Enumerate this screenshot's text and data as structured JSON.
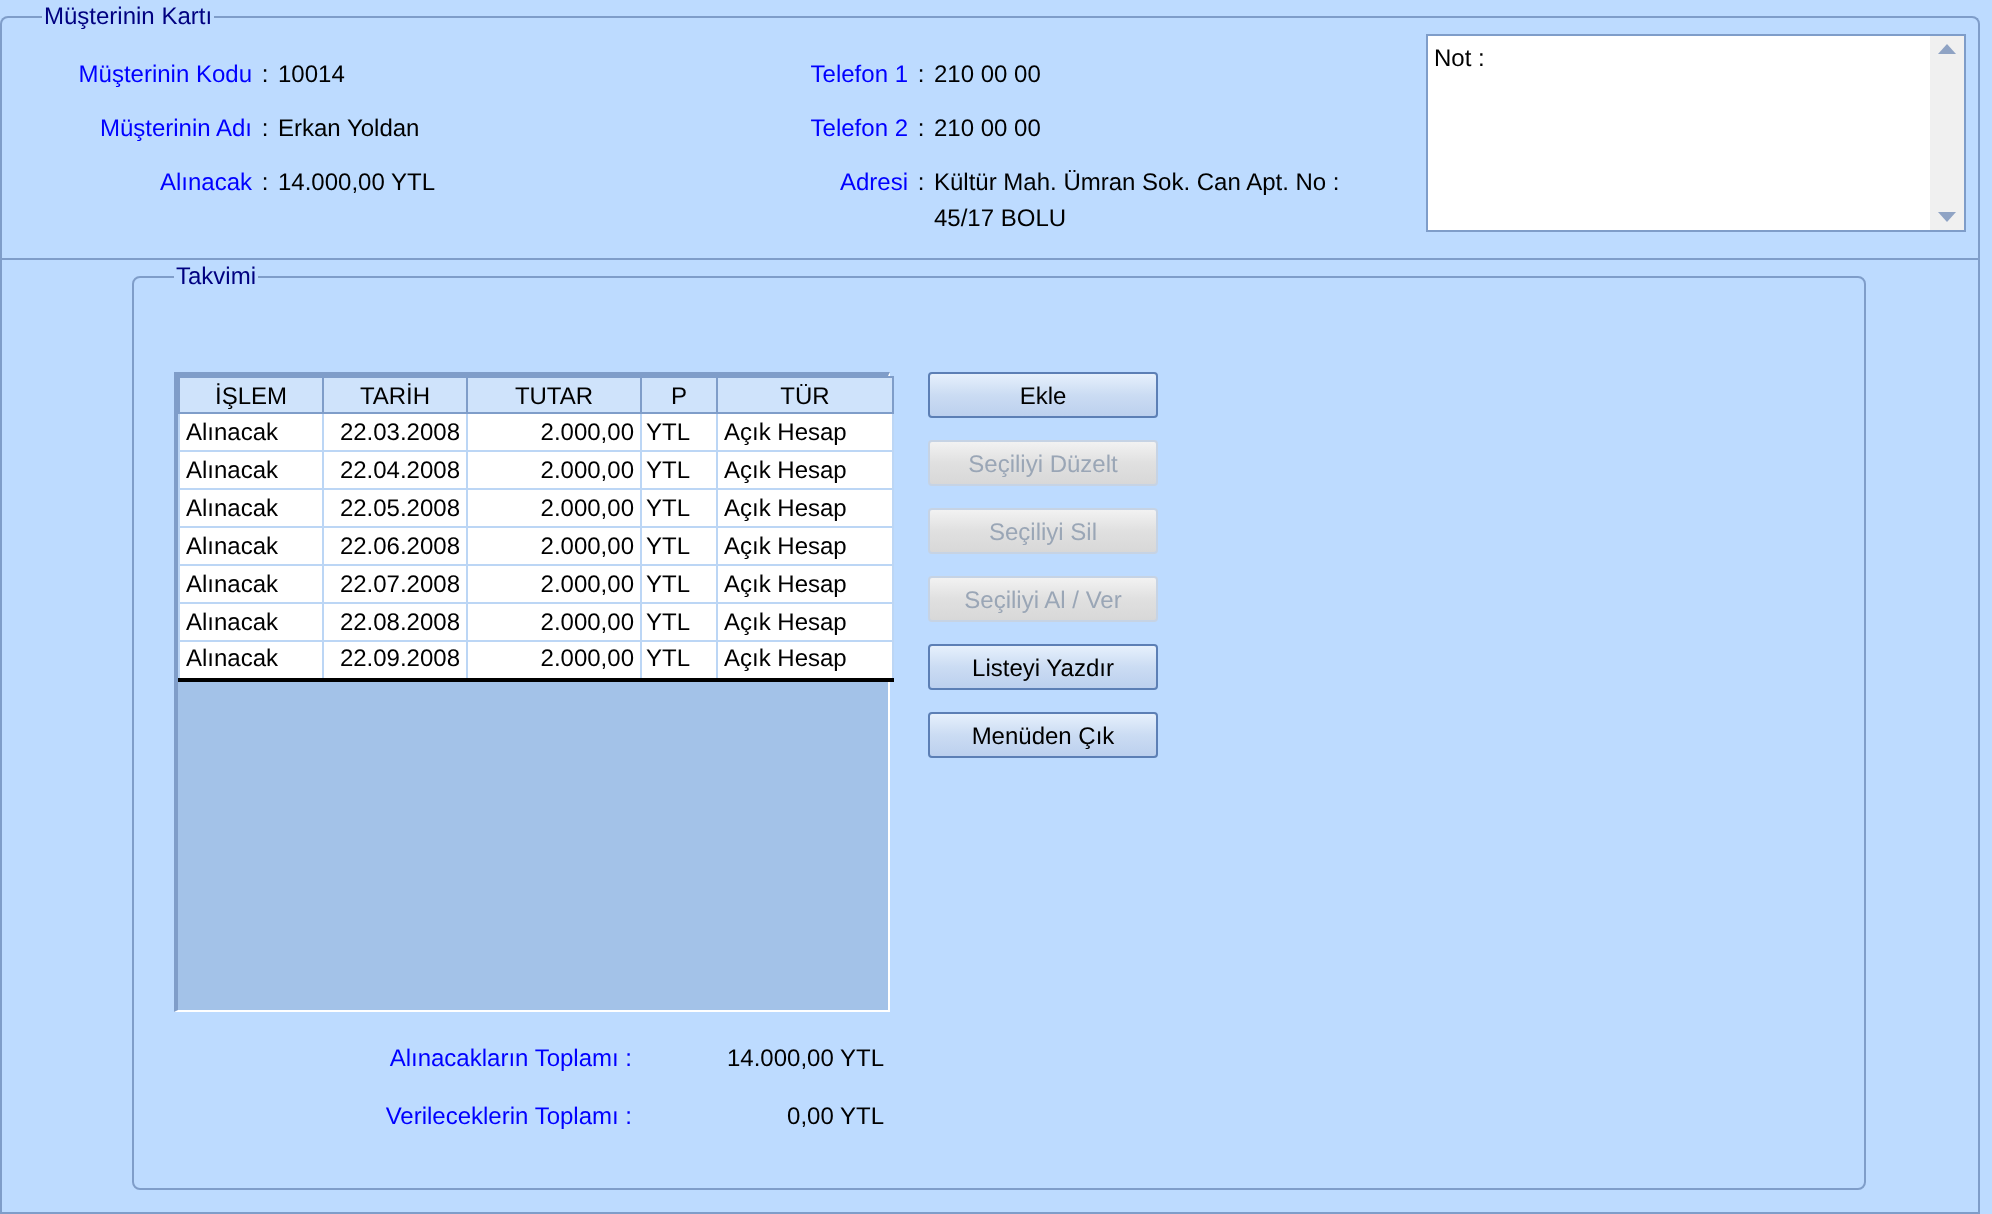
{
  "customer_card": {
    "title": "Müşterinin Kartı",
    "fields_left": [
      {
        "label": "Müşterinin Kodu",
        "separator": ":",
        "value": "10014"
      },
      {
        "label": "Müşterinin Adı",
        "separator": ":",
        "value": "Erkan Yoldan"
      },
      {
        "label": "Alınacak",
        "separator": ":",
        "value": "14.000,00 YTL"
      }
    ],
    "fields_right": [
      {
        "label": "Telefon 1",
        "separator": ":",
        "value": "210 00 00"
      },
      {
        "label": "Telefon 2",
        "separator": ":",
        "value": "210 00 00"
      },
      {
        "label": "Adresi",
        "separator": ":",
        "value": "Kültür Mah. Ümran Sok. Can Apt. No : 45/17 BOLU"
      }
    ],
    "note": {
      "value": "Not :"
    }
  },
  "schedule": {
    "title": "Takvimi",
    "table": {
      "columns": [
        "İŞLEM",
        "TARİH",
        "TUTAR",
        "P",
        "TÜR"
      ],
      "rows": [
        [
          "Alınacak",
          "22.03.2008",
          "2.000,00",
          "YTL",
          "Açık Hesap"
        ],
        [
          "Alınacak",
          "22.04.2008",
          "2.000,00",
          "YTL",
          "Açık Hesap"
        ],
        [
          "Alınacak",
          "22.05.2008",
          "2.000,00",
          "YTL",
          "Açık Hesap"
        ],
        [
          "Alınacak",
          "22.06.2008",
          "2.000,00",
          "YTL",
          "Açık Hesap"
        ],
        [
          "Alınacak",
          "22.07.2008",
          "2.000,00",
          "YTL",
          "Açık Hesap"
        ],
        [
          "Alınacak",
          "22.08.2008",
          "2.000,00",
          "YTL",
          "Açık Hesap"
        ],
        [
          "Alınacak",
          "22.09.2008",
          "2.000,00",
          "YTL",
          "Açık Hesap"
        ]
      ]
    },
    "buttons": [
      {
        "label": "Ekle",
        "disabled": false
      },
      {
        "label": "Seçiliyi Düzelt",
        "disabled": true
      },
      {
        "label": "Seçiliyi Sil",
        "disabled": true
      },
      {
        "label": "Seçiliyi Al / Ver",
        "disabled": true
      },
      {
        "label": "Listeyi Yazdır",
        "disabled": false
      },
      {
        "label": "Menüden Çık",
        "disabled": false
      }
    ],
    "totals": [
      {
        "label": "Alınacakların Toplamı :",
        "value": "14.000,00 YTL"
      },
      {
        "label": "Verileceklerin Toplamı :",
        "value": "0,00 YTL"
      }
    ]
  }
}
